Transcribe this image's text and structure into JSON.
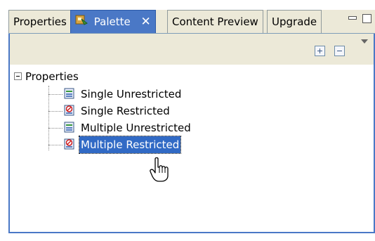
{
  "tabs": [
    {
      "label": "Properties",
      "active": false
    },
    {
      "label": "Palette",
      "active": true,
      "close": "✕"
    },
    {
      "label": "Content Preview",
      "active": false
    },
    {
      "label": "Upgrade",
      "active": false
    }
  ],
  "tree": {
    "root_label": "Properties",
    "expander": "−",
    "items": [
      {
        "label": "Single Unrestricted",
        "icon": "unrestricted-property-icon"
      },
      {
        "label": "Single Restricted",
        "icon": "restricted-property-icon"
      },
      {
        "label": "Multiple Unrestricted",
        "icon": "unrestricted-property-icon"
      },
      {
        "label": "Multiple Restricted",
        "icon": "restricted-property-icon",
        "selected": true
      }
    ]
  },
  "colors": {
    "active_tab": "#4a78c6",
    "selection": "#316ac5",
    "chrome": "#ece9d8"
  }
}
